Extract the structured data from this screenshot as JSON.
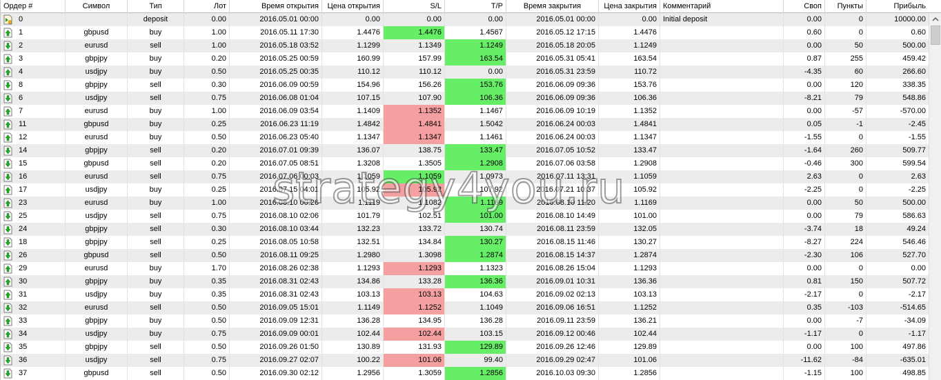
{
  "columns": [
    "Ордер #",
    "Символ",
    "Тип",
    "Лот",
    "Время открытия",
    "Цена открытия",
    "S/L",
    "T/P",
    "Время закрытия",
    "Цена закрытия",
    "Комментарий",
    "Своп",
    "Пункты",
    "Прибыль"
  ],
  "rows": [
    {
      "order": "0",
      "symbol": "",
      "type": "deposit",
      "lot": "0.00",
      "open_time": "2016.05.01 00:00",
      "open_price": "0.00",
      "sl": "0.00",
      "tp": "0.00",
      "close_time": "2016.05.01 00:00",
      "close_price": "0.00",
      "comment": "Initial deposit",
      "swap": "0.00",
      "points": "0",
      "profit": "10000.00",
      "sl_hl": "",
      "tp_hl": "",
      "icon": "deposit-icon"
    },
    {
      "order": "1",
      "symbol": "gbpusd",
      "type": "buy",
      "lot": "1.00",
      "open_time": "2016.05.11 17:30",
      "open_price": "1.4476",
      "sl": "1.4476",
      "tp": "1.4567",
      "close_time": "2016.05.12 17:15",
      "close_price": "1.4476",
      "comment": "",
      "swap": "0.60",
      "points": "0",
      "profit": "0.60",
      "sl_hl": "green",
      "tp_hl": "",
      "icon": "buy-icon"
    },
    {
      "order": "2",
      "symbol": "eurusd",
      "type": "sell",
      "lot": "1.00",
      "open_time": "2016.05.18 03:52",
      "open_price": "1.1299",
      "sl": "1.1349",
      "tp": "1.1249",
      "close_time": "2016.05.18 20:05",
      "close_price": "1.1249",
      "comment": "",
      "swap": "0.00",
      "points": "50",
      "profit": "500.00",
      "sl_hl": "",
      "tp_hl": "green",
      "icon": "sell-icon"
    },
    {
      "order": "3",
      "symbol": "gbpjpy",
      "type": "buy",
      "lot": "0.20",
      "open_time": "2016.05.25 00:59",
      "open_price": "160.99",
      "sl": "157.99",
      "tp": "163.54",
      "close_time": "2016.05.31 05:41",
      "close_price": "163.54",
      "comment": "",
      "swap": "0.87",
      "points": "255",
      "profit": "459.42",
      "sl_hl": "",
      "tp_hl": "green",
      "icon": "buy-icon"
    },
    {
      "order": "4",
      "symbol": "usdjpy",
      "type": "buy",
      "lot": "0.50",
      "open_time": "2016.05.25 00:35",
      "open_price": "110.12",
      "sl": "110.12",
      "tp": "0.00",
      "close_time": "2016.05.31 23:59",
      "close_price": "110.72",
      "comment": "",
      "swap": "-4.35",
      "points": "60",
      "profit": "266.60",
      "sl_hl": "",
      "tp_hl": "",
      "icon": "buy-icon"
    },
    {
      "order": "8",
      "symbol": "gbpjpy",
      "type": "sell",
      "lot": "0.30",
      "open_time": "2016.06.09 00:59",
      "open_price": "154.96",
      "sl": "156.26",
      "tp": "153.76",
      "close_time": "2016.06.09 09:36",
      "close_price": "153.76",
      "comment": "",
      "swap": "0.00",
      "points": "120",
      "profit": "338.35",
      "sl_hl": "",
      "tp_hl": "green",
      "icon": "sell-icon"
    },
    {
      "order": "6",
      "symbol": "usdjpy",
      "type": "sell",
      "lot": "0.75",
      "open_time": "2016.06.08 01:04",
      "open_price": "107.15",
      "sl": "107.90",
      "tp": "106.36",
      "close_time": "2016.06.09 09:36",
      "close_price": "106.36",
      "comment": "",
      "swap": "-8.21",
      "points": "79",
      "profit": "548.86",
      "sl_hl": "",
      "tp_hl": "green",
      "icon": "sell-icon"
    },
    {
      "order": "7",
      "symbol": "eurusd",
      "type": "buy",
      "lot": "1.00",
      "open_time": "2016.06.09 03:54",
      "open_price": "1.1409",
      "sl": "1.1352",
      "tp": "1.1467",
      "close_time": "2016.06.09 10:19",
      "close_price": "1.1352",
      "comment": "",
      "swap": "0.00",
      "points": "-57",
      "profit": "-570.00",
      "sl_hl": "red",
      "tp_hl": "",
      "icon": "buy-icon"
    },
    {
      "order": "11",
      "symbol": "gbpusd",
      "type": "buy",
      "lot": "0.25",
      "open_time": "2016.06.23 11:19",
      "open_price": "1.4842",
      "sl": "1.4841",
      "tp": "1.5042",
      "close_time": "2016.06.24 00:03",
      "close_price": "1.4841",
      "comment": "",
      "swap": "0.05",
      "points": "-1",
      "profit": "-2.45",
      "sl_hl": "red",
      "tp_hl": "",
      "icon": "buy-icon"
    },
    {
      "order": "12",
      "symbol": "eurusd",
      "type": "buy",
      "lot": "0.50",
      "open_time": "2016.06.23 05:40",
      "open_price": "1.1347",
      "sl": "1.1347",
      "tp": "1.1461",
      "close_time": "2016.06.24 00:03",
      "close_price": "1.1347",
      "comment": "",
      "swap": "-1.55",
      "points": "0",
      "profit": "-1.55",
      "sl_hl": "red",
      "tp_hl": "",
      "icon": "buy-icon"
    },
    {
      "order": "14",
      "symbol": "gbpjpy",
      "type": "sell",
      "lot": "0.20",
      "open_time": "2016.07.01 09:39",
      "open_price": "136.07",
      "sl": "138.75",
      "tp": "133.47",
      "close_time": "2016.07.05 10:52",
      "close_price": "133.47",
      "comment": "",
      "swap": "-1.64",
      "points": "260",
      "profit": "509.77",
      "sl_hl": "",
      "tp_hl": "green",
      "icon": "sell-icon"
    },
    {
      "order": "15",
      "symbol": "gbpusd",
      "type": "sell",
      "lot": "0.20",
      "open_time": "2016.07.05 08:51",
      "open_price": "1.3208",
      "sl": "1.3505",
      "tp": "1.2908",
      "close_time": "2016.07.06 03:58",
      "close_price": "1.2908",
      "comment": "",
      "swap": "-0.46",
      "points": "300",
      "profit": "599.54",
      "sl_hl": "",
      "tp_hl": "green",
      "icon": "sell-icon"
    },
    {
      "order": "16",
      "symbol": "eurusd",
      "type": "sell",
      "lot": "0.75",
      "open_time": "2016.07.06 00:03",
      "open_price": "1.1059",
      "sl": "1.1059",
      "tp": "1.0973",
      "close_time": "2016.07.11 13:31",
      "close_price": "1.1059",
      "comment": "",
      "swap": "2.63",
      "points": "0",
      "profit": "2.63",
      "sl_hl": "green",
      "tp_hl": "",
      "icon": "sell-icon"
    },
    {
      "order": "17",
      "symbol": "usdjpy",
      "type": "buy",
      "lot": "0.25",
      "open_time": "2016.07.15 04:01",
      "open_price": "105.92",
      "sl": "105.92",
      "tp": "107.92",
      "close_time": "2016.07.21 10:37",
      "close_price": "105.92",
      "comment": "",
      "swap": "-2.25",
      "points": "0",
      "profit": "-2.25",
      "sl_hl": "red",
      "tp_hl": "",
      "icon": "buy-icon"
    },
    {
      "order": "23",
      "symbol": "eurusd",
      "type": "buy",
      "lot": "1.00",
      "open_time": "2016.08.10 00:26",
      "open_price": "1.1119",
      "sl": "1.1082",
      "tp": "1.1169",
      "close_time": "2016.08.10 11:20",
      "close_price": "1.1169",
      "comment": "",
      "swap": "0.00",
      "points": "50",
      "profit": "500.00",
      "sl_hl": "",
      "tp_hl": "green",
      "icon": "buy-icon"
    },
    {
      "order": "25",
      "symbol": "usdjpy",
      "type": "sell",
      "lot": "0.75",
      "open_time": "2016.08.10 02:06",
      "open_price": "101.79",
      "sl": "102.51",
      "tp": "101.00",
      "close_time": "2016.08.10 14:49",
      "close_price": "101.00",
      "comment": "",
      "swap": "0.00",
      "points": "79",
      "profit": "586.63",
      "sl_hl": "",
      "tp_hl": "green",
      "icon": "sell-icon"
    },
    {
      "order": "24",
      "symbol": "gbpjpy",
      "type": "sell",
      "lot": "0.30",
      "open_time": "2016.08.10 03:44",
      "open_price": "132.23",
      "sl": "133.72",
      "tp": "130.74",
      "close_time": "2016.08.11 23:59",
      "close_price": "132.05",
      "comment": "",
      "swap": "-3.74",
      "points": "18",
      "profit": "49.24",
      "sl_hl": "",
      "tp_hl": "",
      "icon": "sell-icon"
    },
    {
      "order": "18",
      "symbol": "gbpjpy",
      "type": "sell",
      "lot": "0.25",
      "open_time": "2016.08.05 10:58",
      "open_price": "132.51",
      "sl": "134.84",
      "tp": "130.27",
      "close_time": "2016.08.15 11:46",
      "close_price": "130.27",
      "comment": "",
      "swap": "-8.27",
      "points": "224",
      "profit": "546.46",
      "sl_hl": "",
      "tp_hl": "green",
      "icon": "sell-icon"
    },
    {
      "order": "26",
      "symbol": "gbpusd",
      "type": "sell",
      "lot": "0.50",
      "open_time": "2016.08.11 09:25",
      "open_price": "1.2980",
      "sl": "1.3098",
      "tp": "1.2874",
      "close_time": "2016.08.15 14:37",
      "close_price": "1.2874",
      "comment": "",
      "swap": "-2.30",
      "points": "106",
      "profit": "527.70",
      "sl_hl": "",
      "tp_hl": "green",
      "icon": "sell-icon"
    },
    {
      "order": "29",
      "symbol": "eurusd",
      "type": "buy",
      "lot": "1.70",
      "open_time": "2016.08.26 02:38",
      "open_price": "1.1293",
      "sl": "1.1293",
      "tp": "1.1323",
      "close_time": "2016.08.26 15:04",
      "close_price": "1.1293",
      "comment": "",
      "swap": "0.00",
      "points": "0",
      "profit": "0.00",
      "sl_hl": "red",
      "tp_hl": "",
      "icon": "buy-icon"
    },
    {
      "order": "30",
      "symbol": "gbpjpy",
      "type": "buy",
      "lot": "0.35",
      "open_time": "2016.08.31 02:43",
      "open_price": "134.86",
      "sl": "133.28",
      "tp": "136.36",
      "close_time": "2016.09.01 10:31",
      "close_price": "136.36",
      "comment": "",
      "swap": "0.81",
      "points": "150",
      "profit": "507.72",
      "sl_hl": "",
      "tp_hl": "green",
      "icon": "buy-icon"
    },
    {
      "order": "31",
      "symbol": "usdjpy",
      "type": "buy",
      "lot": "0.35",
      "open_time": "2016.08.31 02:43",
      "open_price": "103.13",
      "sl": "103.13",
      "tp": "104.63",
      "close_time": "2016.09.02 02:13",
      "close_price": "103.13",
      "comment": "",
      "swap": "-2.17",
      "points": "0",
      "profit": "-2.17",
      "sl_hl": "red",
      "tp_hl": "",
      "icon": "buy-icon"
    },
    {
      "order": "32",
      "symbol": "eurusd",
      "type": "sell",
      "lot": "0.50",
      "open_time": "2016.09.05 15:01",
      "open_price": "1.1149",
      "sl": "1.1252",
      "tp": "1.1049",
      "close_time": "2016.09.06 16:51",
      "close_price": "1.1252",
      "comment": "",
      "swap": "0.35",
      "points": "-103",
      "profit": "-514.65",
      "sl_hl": "red",
      "tp_hl": "",
      "icon": "sell-icon"
    },
    {
      "order": "33",
      "symbol": "gbpjpy",
      "type": "buy",
      "lot": "0.50",
      "open_time": "2016.09.09 12:31",
      "open_price": "136.28",
      "sl": "134.95",
      "tp": "136.28",
      "close_time": "2016.09.11 23:59",
      "close_price": "136.21",
      "comment": "",
      "swap": "0.00",
      "points": "-7",
      "profit": "-34.09",
      "sl_hl": "",
      "tp_hl": "",
      "icon": "buy-icon"
    },
    {
      "order": "34",
      "symbol": "usdjpy",
      "type": "buy",
      "lot": "0.75",
      "open_time": "2016.09.09 00:01",
      "open_price": "102.44",
      "sl": "102.44",
      "tp": "103.15",
      "close_time": "2016.09.12 00:46",
      "close_price": "102.44",
      "comment": "",
      "swap": "-1.17",
      "points": "0",
      "profit": "-1.17",
      "sl_hl": "red",
      "tp_hl": "",
      "icon": "buy-icon"
    },
    {
      "order": "35",
      "symbol": "gbpjpy",
      "type": "sell",
      "lot": "0.50",
      "open_time": "2016.09.26 01:50",
      "open_price": "130.89",
      "sl": "131.93",
      "tp": "129.89",
      "close_time": "2016.09.26 12:46",
      "close_price": "129.89",
      "comment": "",
      "swap": "0.00",
      "points": "100",
      "profit": "497.86",
      "sl_hl": "",
      "tp_hl": "green",
      "icon": "sell-icon"
    },
    {
      "order": "36",
      "symbol": "usdjpy",
      "type": "sell",
      "lot": "0.75",
      "open_time": "2016.09.27 02:07",
      "open_price": "100.22",
      "sl": "101.06",
      "tp": "99.40",
      "close_time": "2016.09.29 02:47",
      "close_price": "101.06",
      "comment": "",
      "swap": "-11.62",
      "points": "-84",
      "profit": "-635.01",
      "sl_hl": "red",
      "tp_hl": "",
      "icon": "sell-icon"
    },
    {
      "order": "37",
      "symbol": "gbpusd",
      "type": "sell",
      "lot": "0.50",
      "open_time": "2016.09.30 02:12",
      "open_price": "1.2956",
      "sl": "1.3059",
      "tp": "1.2856",
      "close_time": "2016.10.03 09:30",
      "close_price": "1.2856",
      "comment": "",
      "swap": "-1.15",
      "points": "100",
      "profit": "498.85",
      "sl_hl": "",
      "tp_hl": "green",
      "icon": "sell-icon"
    }
  ],
  "watermark": "strategy4you.ru",
  "colors": {
    "green_highlight": "#66ee66",
    "red_highlight": "#f4a0a0",
    "alt_row": "#ececec"
  }
}
